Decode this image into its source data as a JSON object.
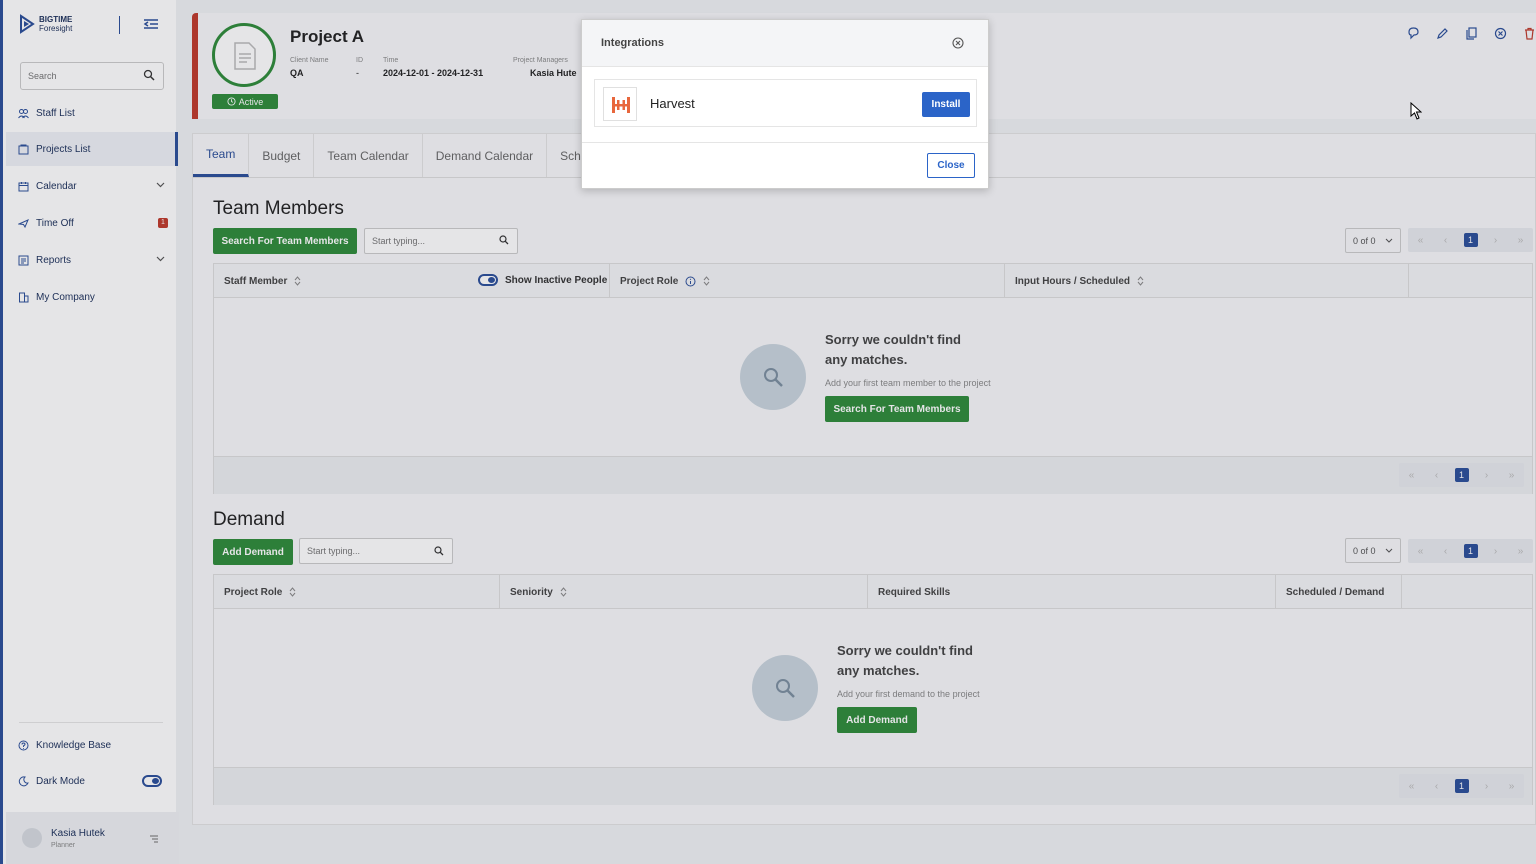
{
  "sidebar": {
    "brand_line1": "BIGTIME",
    "brand_line2": "Foresight",
    "search_placeholder": "Search",
    "items": [
      {
        "label": "Staff List"
      },
      {
        "label": "Projects List"
      },
      {
        "label": "Calendar"
      },
      {
        "label": "Time Off",
        "badge": "1"
      },
      {
        "label": "Reports"
      },
      {
        "label": "My Company"
      }
    ],
    "bottom_items": [
      {
        "label": "Knowledge Base"
      },
      {
        "label": "Dark Mode"
      }
    ],
    "user": {
      "name": "Kasia Hutek",
      "role": "Planner"
    }
  },
  "project": {
    "title": "Project A",
    "status": "Active",
    "client_label": "Client Name",
    "client_value": "QA",
    "id_label": "ID",
    "id_value": "-",
    "time_label": "Time",
    "time_value": "2024-12-01 - 2024-12-31",
    "managers_label": "Project Managers",
    "managers_value": "Kasia Hute"
  },
  "tabs": [
    {
      "label": "Team"
    },
    {
      "label": "Budget"
    },
    {
      "label": "Team Calendar"
    },
    {
      "label": "Demand Calendar"
    },
    {
      "label": "Sched"
    }
  ],
  "team": {
    "title": "Team Members",
    "search_button": "Search For Team Members",
    "filter_placeholder": "Start typing...",
    "count": "0 of 0",
    "page": "1",
    "columns": [
      "Staff Member",
      "Show Inactive People",
      "Project Role",
      "Input Hours / Scheduled"
    ],
    "empty_title": "Sorry we couldn't find any matches.",
    "empty_sub": "Add your first team member to the project",
    "empty_button": "Search For Team Members"
  },
  "demand": {
    "title": "Demand",
    "add_button": "Add Demand",
    "filter_placeholder": "Start typing...",
    "count": "0 of 0",
    "page": "1",
    "columns": [
      "Project Role",
      "Seniority",
      "Required Skills",
      "Scheduled / Demand"
    ],
    "empty_title": "Sorry we couldn't find any matches.",
    "empty_sub": "Add your first demand to the project",
    "empty_button": "Add Demand"
  },
  "modal": {
    "title": "Integrations",
    "integration_name": "Harvest",
    "install_label": "Install",
    "close_label": "Close"
  },
  "colors": {
    "brand": "#2b4f9a",
    "green": "#2e8b3a",
    "red": "#c0392b",
    "install": "#2b64c8",
    "harvest": "#e8673c"
  }
}
